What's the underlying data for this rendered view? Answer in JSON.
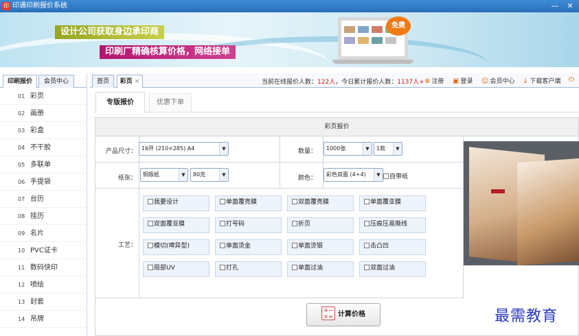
{
  "window": {
    "title": "印通印刷报价系统",
    "minimize_glyph": "—",
    "close_glyph": "✕"
  },
  "banner": {
    "line1": "设计公司获取身边承印商",
    "line2": "印刷厂精确核算价格，网络接单",
    "badge": "免费"
  },
  "sidebar": {
    "tabs": [
      {
        "label": "印刷报价"
      },
      {
        "label": "会员中心"
      }
    ],
    "items": [
      {
        "num": "01",
        "label": "彩页"
      },
      {
        "num": "02",
        "label": "画册"
      },
      {
        "num": "03",
        "label": "彩盒"
      },
      {
        "num": "04",
        "label": "不干胶"
      },
      {
        "num": "05",
        "label": "多联单"
      },
      {
        "num": "06",
        "label": "手提袋"
      },
      {
        "num": "07",
        "label": "台历"
      },
      {
        "num": "08",
        "label": "挂历"
      },
      {
        "num": "09",
        "label": "名片"
      },
      {
        "num": "10",
        "label": "PVC证卡"
      },
      {
        "num": "11",
        "label": "数码快印"
      },
      {
        "num": "12",
        "label": "喷绘"
      },
      {
        "num": "13",
        "label": "封套"
      },
      {
        "num": "14",
        "label": "吊牌"
      }
    ]
  },
  "topbar": {
    "tabs": [
      {
        "label": "首页"
      },
      {
        "label": "彩页",
        "close": "×"
      }
    ],
    "stats": {
      "online_label": "当前在线报价人数：",
      "online_value": "122人",
      "today_label": "，今日累计报价人数：",
      "today_value": "1137人",
      "plus": "+"
    },
    "buttons": [
      {
        "icon": "register-icon",
        "glyph": "⊕",
        "label": "注册"
      },
      {
        "icon": "login-icon",
        "glyph": "▣",
        "label": "登录"
      },
      {
        "icon": "user-icon",
        "glyph": "☺",
        "label": "会员中心"
      },
      {
        "icon": "download-icon",
        "glyph": "↓",
        "label": "下载客户端"
      },
      {
        "icon": "power-icon",
        "glyph": "⏻",
        "label": ""
      }
    ]
  },
  "subtabs": [
    {
      "label": "专版报价"
    },
    {
      "label": "优惠下单"
    }
  ],
  "form": {
    "heading": "彩页报价",
    "size_label": "产品尺寸：",
    "size_value": "16开 (210×285) A4",
    "qty_label": "数量：",
    "qty_value": "1000张",
    "kinds_value": "1款",
    "paper_label": "纸张：",
    "paper_value": "铜版纸",
    "weight_value": "80克",
    "color_label": "颜色：",
    "color_value": "彩色双面 (4+4)",
    "selfpaper_label": "自带纸",
    "craft_label": "工艺：",
    "crafts": [
      "我要设计",
      "单面覆亮膜",
      "双面覆亮膜",
      "单面覆亚膜",
      "双面覆亚膜",
      "打号码",
      "折页",
      "压痕压易撕线",
      "模切(啤异型)",
      "单面烫金",
      "单面烫银",
      "击凸凹",
      "局部UV",
      "打孔",
      "单面过油",
      "双面过油"
    ],
    "calc_button": "计算价格",
    "calc_icon_glyph": "+−\n×="
  },
  "watermark": "最需教育",
  "colors": {
    "title_bar": "#2a6fb8",
    "accent_red": "#dd1111",
    "banner_green": "#96a51f",
    "banner_magenta": "#b2166f"
  }
}
